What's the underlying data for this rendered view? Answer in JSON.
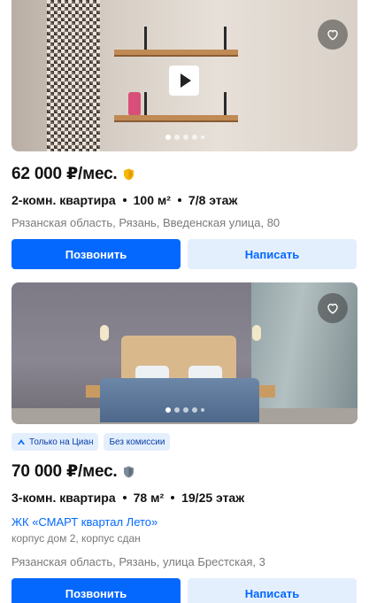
{
  "listings": [
    {
      "price": "62 000 ₽/мес.",
      "specs": {
        "rooms": "2-комн. квартира",
        "area": "100 м²",
        "floor": "7/8 этаж"
      },
      "address": "Рязанская область, Рязань, Введенская улица, 80",
      "shield_color": "#f5b70a",
      "has_video": true,
      "photo_count": 5,
      "active_photo": 1,
      "buttons": {
        "call": "Позвонить",
        "message": "Написать"
      }
    },
    {
      "badges": [
        {
          "label": "Только на Циан",
          "icon": "cian-logo-icon"
        },
        {
          "label": "Без комиссии"
        }
      ],
      "price": "70 000 ₽/мес.",
      "specs": {
        "rooms": "3-комн. квартира",
        "area": "78 м²",
        "floor": "19/25 этаж"
      },
      "complex": "ЖК «СМАРТ квартал Лето»",
      "building": "корпус дом 2, корпус сдан",
      "address": "Рязанская область, Рязань, улица Брестская, 3",
      "shield_color": "#7d8a99",
      "photo_count": 5,
      "active_photo": 1,
      "buttons": {
        "call": "Позвонить",
        "message": "Написать"
      }
    }
  ],
  "colors": {
    "primary": "#0468ff",
    "secondary_bg": "#e4effd",
    "muted_text": "#7a7a7a"
  }
}
